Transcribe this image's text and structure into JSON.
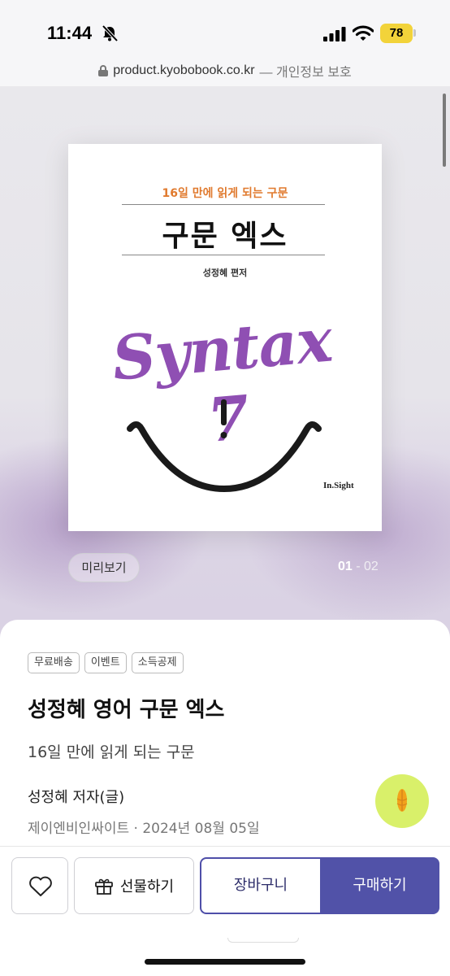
{
  "status_bar": {
    "time": "11:44",
    "battery": "78",
    "battery_color": "#f2d33a",
    "icons": [
      "bell-slash-icon",
      "signal-icon",
      "wifi-icon",
      "battery-icon"
    ]
  },
  "url_bar": {
    "domain": "product.kyobobook.co.kr",
    "note": "— 개인정보 보호"
  },
  "cover": {
    "subtitle": "16일 만에 읽게 되는 구문",
    "title": "구문 엑스",
    "author": "성정혜 편저",
    "logo_text": "Syntax 7",
    "publisher": "In.Sight"
  },
  "hero": {
    "preview_label": "미리보기",
    "page_current": "01",
    "page_total": " - 02"
  },
  "product": {
    "tags": [
      "무료배송",
      "이벤트",
      "소득공제"
    ],
    "title": "성정혜 영어 구문 엑스",
    "subtitle": "16일 만에 읽게 되는 구문",
    "author": "성정혜 저자(글)",
    "publisher_date": "제이엔비인싸이트 · 2024년 08월 05일"
  },
  "actions": {
    "wish_icon": "heart-icon",
    "gift_label": "선물하기",
    "cart_label": "장바구니",
    "buy_label": "구매하기",
    "accent_color": "#5152a8"
  }
}
